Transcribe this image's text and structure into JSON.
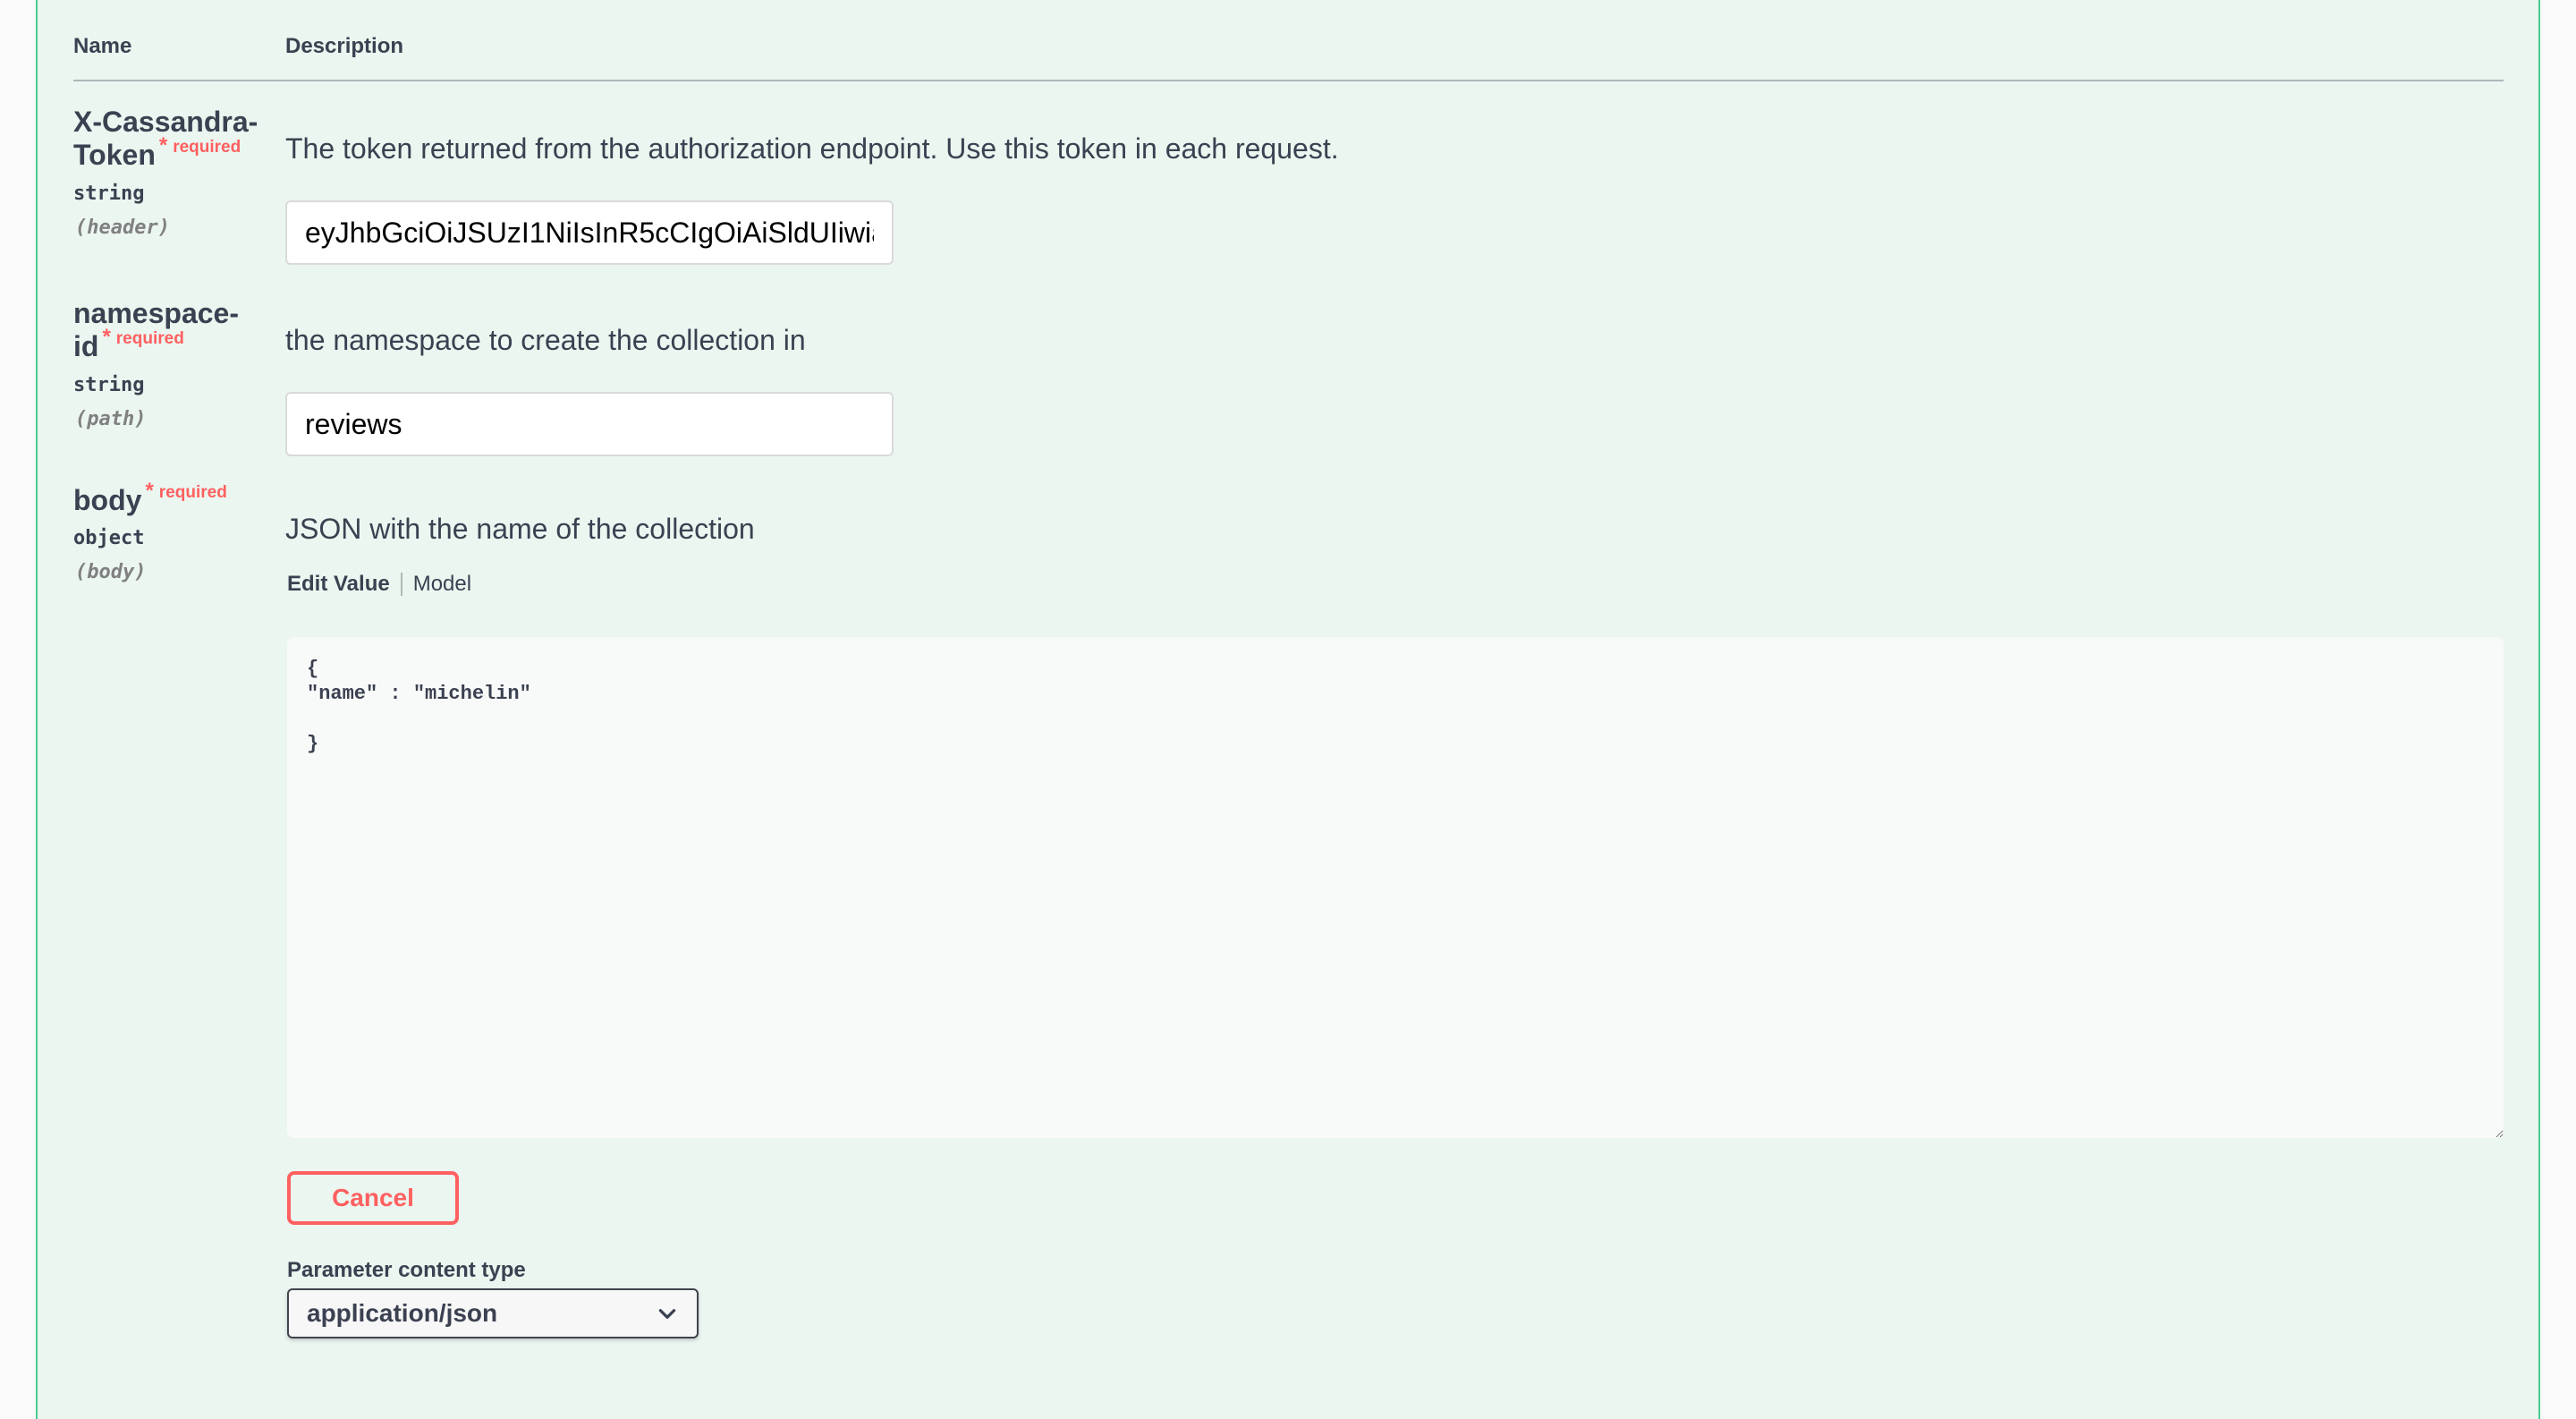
{
  "table": {
    "col_name": "Name",
    "col_description": "Description"
  },
  "required_label": "required",
  "required_star": "*",
  "params": {
    "token": {
      "name_line1": "X-Cassandra-",
      "name_line2": "Token",
      "type": "string",
      "in": "(header)",
      "description": "The token returned from the authorization endpoint. Use this token in each request.",
      "value": "eyJhbGciOiJSUzI1NiIsInR5cCIgOiAiSldUIiwia"
    },
    "namespace": {
      "name_line1": "namespace-",
      "name_line2": "id",
      "type": "string",
      "in": "(path)",
      "description": "the namespace to create the collection in",
      "value": "reviews"
    },
    "body": {
      "name": "body",
      "type": "object",
      "in": "(body)",
      "description": "JSON with the name of the collection",
      "tab_edit": "Edit Value",
      "tab_model": "Model",
      "value": "{\n\"name\" : \"michelin\"\n\n}"
    }
  },
  "cancel_label": "Cancel",
  "content_type": {
    "label": "Parameter content type",
    "selected": "application/json",
    "icon": "chevron-down-icon"
  },
  "colors": {
    "panel_bg": "#ebf6f0",
    "panel_border": "#49cc90",
    "required": "#ff6060",
    "cancel": "#ff6060"
  }
}
